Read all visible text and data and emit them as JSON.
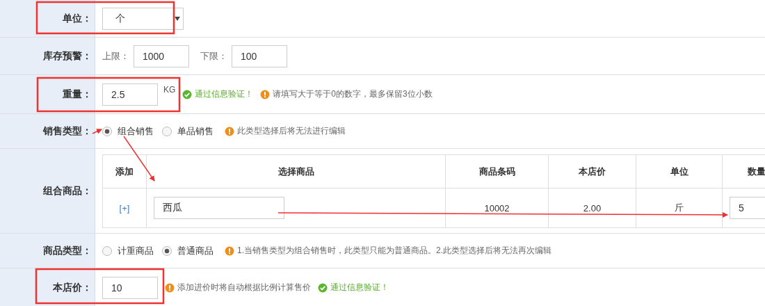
{
  "rows": [
    {
      "kind": "select",
      "label": "单位：",
      "value": "个"
    },
    {
      "kind": "range",
      "label": "库存预警：",
      "fields": [
        {
          "label": "上限：",
          "value": "1000"
        },
        {
          "label": "下限：",
          "value": "100"
        }
      ]
    },
    {
      "kind": "input",
      "label": "重量：",
      "value": "2.5",
      "unit": "KG",
      "messages": [
        {
          "kind": "ok",
          "text": "通过信息验证！"
        },
        {
          "kind": "warn",
          "text": "请填写大于等于0的数字，最多保留3位小数"
        }
      ]
    },
    {
      "kind": "radio",
      "label": "销售类型：",
      "options": [
        {
          "label": "组合销售",
          "selected": true
        },
        {
          "label": "单品销售",
          "selected": false
        }
      ],
      "messages": [
        {
          "kind": "warn",
          "text": "此类型选择后将无法进行编辑"
        }
      ]
    },
    {
      "kind": "table",
      "label": "组合商品：",
      "columns": [
        "添加",
        "选择商品",
        "商品条码",
        "本店价",
        "单位",
        "数量"
      ],
      "rows": [
        {
          "add": "[+]",
          "product": "西瓜",
          "barcode": "10002",
          "price": "2.00",
          "unit": "斤",
          "quantity": "5"
        }
      ]
    },
    {
      "kind": "radio",
      "label": "商品类型：",
      "options": [
        {
          "label": "计重商品",
          "selected": false
        },
        {
          "label": "普通商品",
          "selected": true
        }
      ],
      "messages": [
        {
          "kind": "warn",
          "text": "1.当销售类型为组合销售时，此类型只能为普通商品。2.此类型选择后将无法再次编辑"
        }
      ]
    },
    {
      "kind": "input",
      "label": "本店价：",
      "value": "10",
      "messages": [
        {
          "kind": "warn",
          "text": "添加进价时将自动根据比例计算售价"
        },
        {
          "kind": "ok",
          "text": "通过信息验证！"
        }
      ]
    }
  ]
}
